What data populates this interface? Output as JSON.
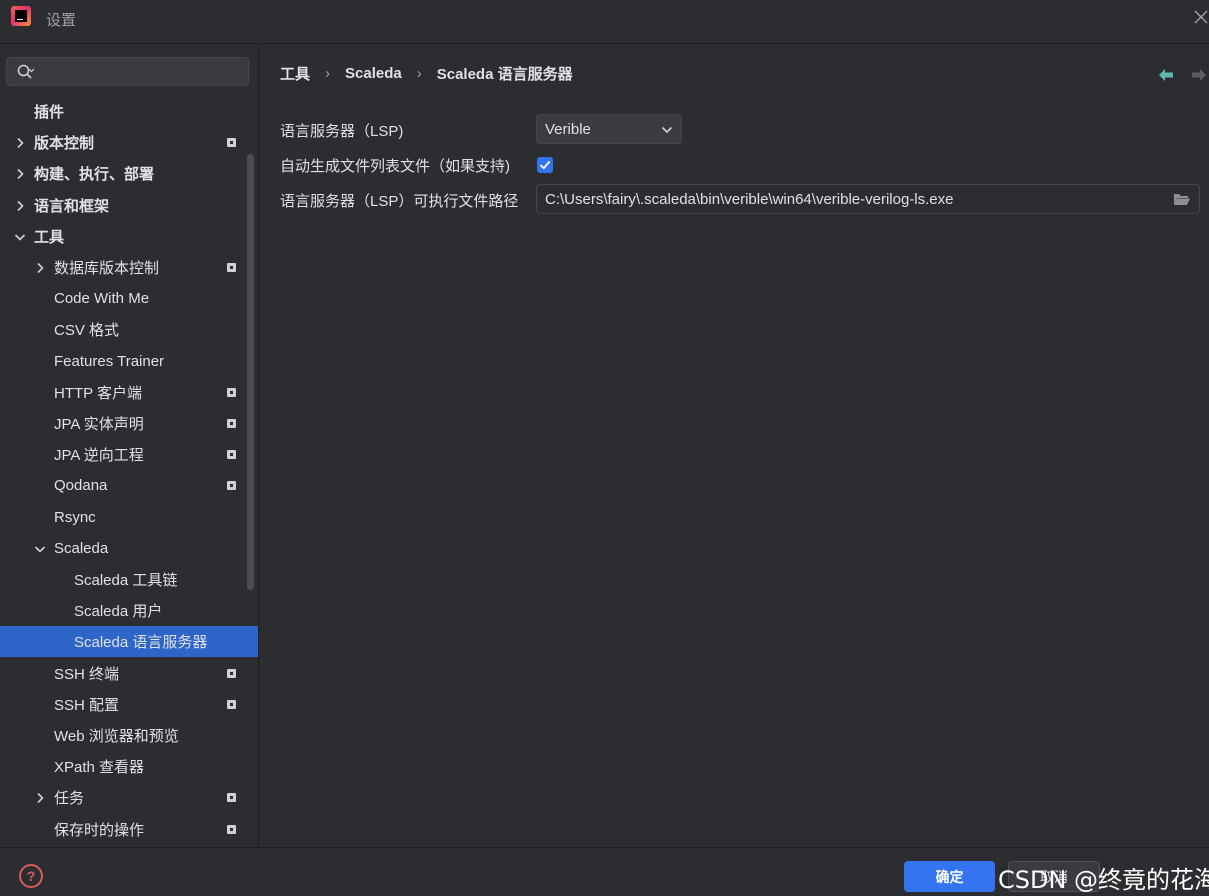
{
  "window": {
    "title": "设置",
    "icon": "intellij-logo-icon"
  },
  "search": {
    "placeholder": "",
    "value": ""
  },
  "tree": [
    {
      "label": "插件",
      "level": 0,
      "bold": true,
      "arrow": "none",
      "badge": false
    },
    {
      "label": "版本控制",
      "level": 0,
      "bold": true,
      "arrow": "right",
      "badge": true
    },
    {
      "label": "构建、执行、部署",
      "level": 0,
      "bold": true,
      "arrow": "right",
      "badge": false
    },
    {
      "label": "语言和框架",
      "level": 0,
      "bold": true,
      "arrow": "right",
      "badge": false
    },
    {
      "label": "工具",
      "level": 0,
      "bold": true,
      "arrow": "down",
      "badge": false
    },
    {
      "label": "数据库版本控制",
      "level": 1,
      "bold": false,
      "arrow": "right",
      "badge": true
    },
    {
      "label": "Code With Me",
      "level": 1,
      "bold": false,
      "arrow": "none",
      "badge": false
    },
    {
      "label": "CSV 格式",
      "level": 1,
      "bold": false,
      "arrow": "none",
      "badge": false
    },
    {
      "label": "Features Trainer",
      "level": 1,
      "bold": false,
      "arrow": "none",
      "badge": false
    },
    {
      "label": "HTTP 客户端",
      "level": 1,
      "bold": false,
      "arrow": "none",
      "badge": true
    },
    {
      "label": "JPA 实体声明",
      "level": 1,
      "bold": false,
      "arrow": "none",
      "badge": true
    },
    {
      "label": "JPA 逆向工程",
      "level": 1,
      "bold": false,
      "arrow": "none",
      "badge": true
    },
    {
      "label": "Qodana",
      "level": 1,
      "bold": false,
      "arrow": "none",
      "badge": true
    },
    {
      "label": "Rsync",
      "level": 1,
      "bold": false,
      "arrow": "none",
      "badge": false
    },
    {
      "label": "Scaleda",
      "level": 1,
      "bold": false,
      "arrow": "down",
      "badge": false
    },
    {
      "label": "Scaleda 工具链",
      "level": 2,
      "bold": false,
      "arrow": "none",
      "badge": false
    },
    {
      "label": "Scaleda 用户",
      "level": 2,
      "bold": false,
      "arrow": "none",
      "badge": false
    },
    {
      "label": "Scaleda 语言服务器",
      "level": 2,
      "bold": false,
      "arrow": "none",
      "badge": false,
      "selected": true
    },
    {
      "label": "SSH 终端",
      "level": 1,
      "bold": false,
      "arrow": "none",
      "badge": true
    },
    {
      "label": "SSH 配置",
      "level": 1,
      "bold": false,
      "arrow": "none",
      "badge": true
    },
    {
      "label": "Web 浏览器和预览",
      "level": 1,
      "bold": false,
      "arrow": "none",
      "badge": false
    },
    {
      "label": "XPath 查看器",
      "level": 1,
      "bold": false,
      "arrow": "none",
      "badge": false
    },
    {
      "label": "任务",
      "level": 1,
      "bold": false,
      "arrow": "right",
      "badge": true
    },
    {
      "label": "保存时的操作",
      "level": 1,
      "bold": false,
      "arrow": "none",
      "badge": true
    }
  ],
  "breadcrumb": [
    "工具",
    "Scaleda",
    "Scaleda 语言服务器"
  ],
  "breadcrumb_separator": "›",
  "form": {
    "lsp_label": "语言服务器（LSP)",
    "lsp_value": "Verible",
    "autogen_label": "自动生成文件列表文件（如果支持)",
    "autogen_checked": true,
    "path_label": "语言服务器（LSP）可执行文件路径",
    "path_value": "C:\\Users\\fairy\\.scaleda\\bin\\verible\\win64\\verible-verilog-ls.exe"
  },
  "footer": {
    "help_label": "?",
    "ok_label": "确定",
    "cancel_label": "取消",
    "watermark": "CSDN @终竟的花海"
  },
  "colors": {
    "accent": "#3574f0",
    "selection": "#2e65c9",
    "help": "#db5c5c",
    "nav_back": "#5fb8b2"
  }
}
